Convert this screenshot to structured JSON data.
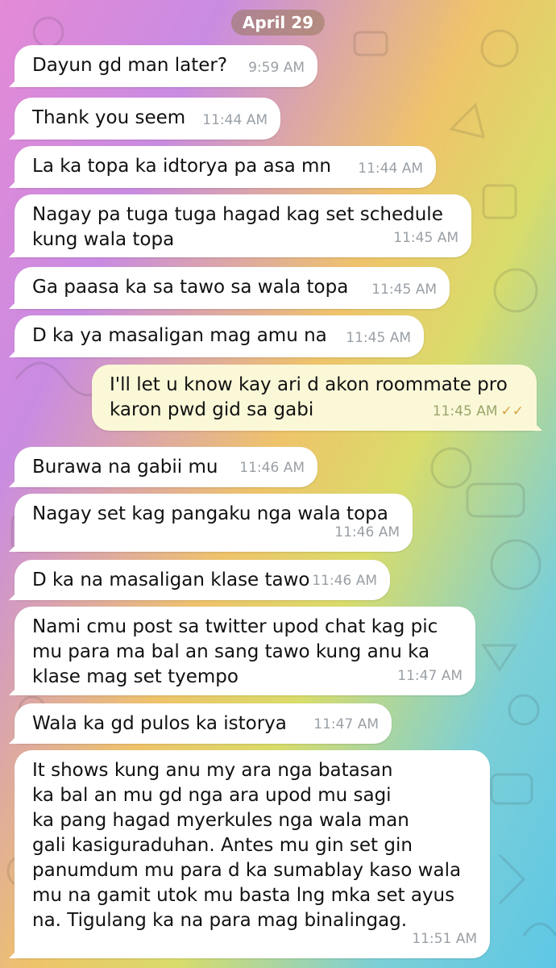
{
  "date_label": "April 29",
  "messages": [
    {
      "text": "Dayun gd man later?",
      "time": "9:59 AM",
      "dir": "in"
    },
    {
      "text": "Thank you seem",
      "time": "11:44 AM",
      "dir": "in"
    },
    {
      "text": "La ka topa ka idtorya pa asa mn",
      "time": "11:44 AM",
      "dir": "in"
    },
    {
      "text": "Nagay pa tuga tuga hagad kag set schedule\nkung wala topa",
      "time": "11:45 AM",
      "dir": "in"
    },
    {
      "text": "Ga paasa ka sa tawo sa wala topa",
      "time": "11:45 AM",
      "dir": "in"
    },
    {
      "text": "D ka ya masaligan mag amu na",
      "time": "11:45 AM",
      "dir": "in"
    },
    {
      "text": "I'll let u know kay ari d akon roommate pro\nkaron pwd gid sa gabi",
      "time": "11:45 AM",
      "dir": "out",
      "status": "read"
    },
    {
      "text": "Burawa na gabii mu",
      "time": "11:46 AM",
      "dir": "in"
    },
    {
      "text": "Nagay set kag pangaku nga wala topa",
      "time": "11:46 AM",
      "dir": "in"
    },
    {
      "text": "D ka na masaligan klase tawo",
      "time": "11:46 AM",
      "dir": "in"
    },
    {
      "text": "Nami cmu post sa twitter upod chat kag pic\nmu para ma bal an sang tawo kung anu ka\nklase mag set tyempo",
      "time": "11:47 AM",
      "dir": "in"
    },
    {
      "text": "Wala ka gd pulos ka istorya",
      "time": "11:47 AM",
      "dir": "in"
    },
    {
      "text": "It shows kung anu my ara nga batasan\nka bal an mu gd nga ara upod mu sagi\nka pang hagad myerkules nga wala man\ngali kasiguraduhan. Antes mu gin set gin\npanumdum mu para d ka sumablay kaso wala\nmu na gamit utok mu basta lng mka set ayus\nna. Tigulang ka na para mag binalingag.",
      "time": "11:51 AM",
      "dir": "in"
    }
  ]
}
